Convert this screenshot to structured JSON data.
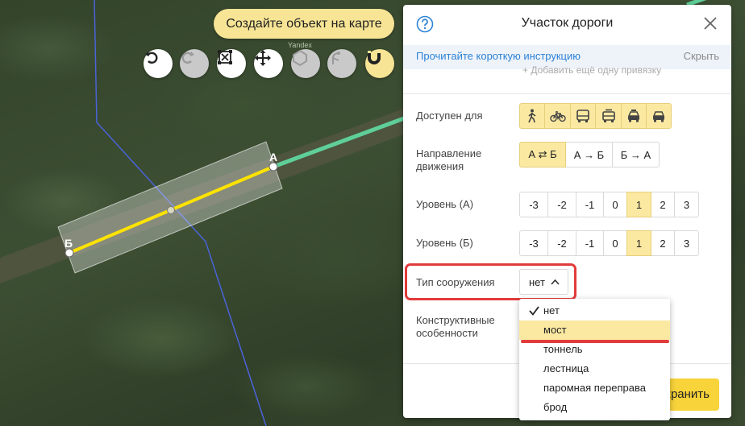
{
  "map": {
    "hint": "Создайте объект на карте",
    "watermark": "Yandex",
    "point_a_label": "А",
    "point_b_label": "Б",
    "toolbar": [
      {
        "name": "undo-button",
        "icon": "undo-icon",
        "state": "enabled"
      },
      {
        "name": "redo-button",
        "icon": "redo-icon",
        "state": "disabled"
      },
      {
        "name": "select-area-button",
        "icon": "select-area-icon",
        "state": "enabled"
      },
      {
        "name": "move-button",
        "icon": "move-icon",
        "state": "enabled"
      },
      {
        "name": "polygon-button",
        "icon": "polygon-icon",
        "state": "disabled"
      },
      {
        "name": "branch-button",
        "icon": "branch-icon",
        "state": "disabled"
      },
      {
        "name": "snap-button",
        "icon": "magnet-icon",
        "state": "active"
      }
    ]
  },
  "panel": {
    "title": "Участок дороги",
    "help_icon": "help-icon",
    "close_icon": "close-icon",
    "info_link": "Прочитайте короткую инструкцию",
    "info_hide": "Скрыть",
    "faded_line": "+ Добавить ещё одну привязку",
    "access": {
      "label": "Доступен для",
      "icons": [
        "pedestrian-icon",
        "bicycle-icon",
        "bus-icon",
        "tram-icon",
        "taxi-icon",
        "car-icon"
      ]
    },
    "direction": {
      "label_line1": "Направление",
      "label_line2": "движения",
      "options": [
        "А ⇄ Б",
        "А → Б",
        "Б → А"
      ],
      "selected": 0
    },
    "level_a": {
      "label": "Уровень (А)",
      "options": [
        "-3",
        "-2",
        "-1",
        "0",
        "1",
        "2",
        "3"
      ],
      "selected": 4
    },
    "level_b": {
      "label": "Уровень (Б)",
      "options": [
        "-3",
        "-2",
        "-1",
        "0",
        "1",
        "2",
        "3"
      ],
      "selected": 4
    },
    "structure_type": {
      "label": "Тип сооружения",
      "value": "нет"
    },
    "constructive": {
      "label_line1": "Конструктивные",
      "label_line2": "особенности"
    },
    "save_label": "Сохранить"
  },
  "dropdown": {
    "items": [
      "нет",
      "мост",
      "тоннель",
      "лестница",
      "паромная переправа",
      "брод"
    ],
    "checked": 0,
    "hovered": 1
  },
  "colors": {
    "accent_yellow": "#f8d33a",
    "selected_bg": "#fbe9a2",
    "link_blue": "#2d82d7",
    "highlight_red": "#e23b3b",
    "road_yellow": "#ffe300",
    "road_green": "#5fcf9a",
    "boundary_blue": "#4a63d8"
  }
}
